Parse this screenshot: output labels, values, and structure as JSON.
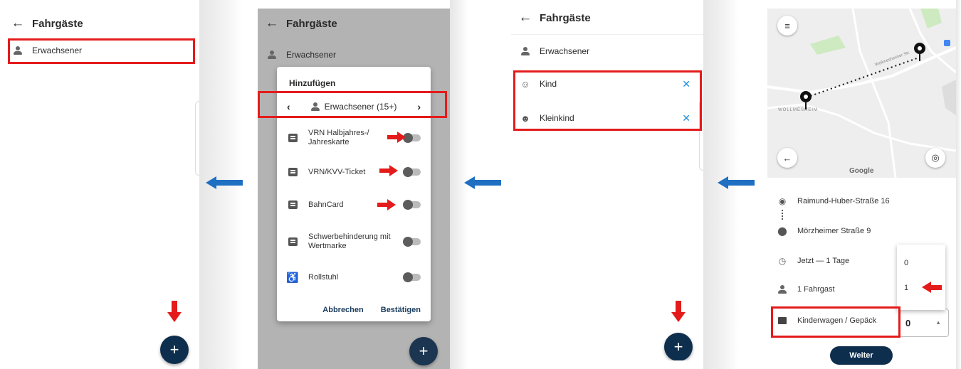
{
  "screen1": {
    "title": "Fahrgäste",
    "passenger": "Erwachsener",
    "fab": "+"
  },
  "screen2": {
    "title": "Fahrgäste",
    "passenger": "Erwachsener",
    "dialog": {
      "title": "Hinzufügen",
      "category": "Erwachsener (15+)",
      "prev": "‹",
      "next": "›",
      "options": [
        {
          "label": "VRN Halbjahres-/ Jahreskarte",
          "enabled": false
        },
        {
          "label": "VRN/KVV-Ticket",
          "enabled": false
        },
        {
          "label": "BahnCard",
          "enabled": false
        },
        {
          "label": "Schwerbehinderung mit Wertmarke",
          "enabled": false
        },
        {
          "label": "Rollstuhl",
          "enabled": false
        }
      ],
      "cancel": "Abbrechen",
      "confirm": "Bestätigen"
    },
    "fab": "+"
  },
  "screen3": {
    "title": "Fahrgäste",
    "passengers": [
      "Erwachsener",
      "Kind",
      "Kleinkind"
    ],
    "remove": "✕",
    "fab": "+"
  },
  "screen4": {
    "map": {
      "street": "Wollmesheimer Str.",
      "place": "WOLLMESHEIM",
      "brand": "Google"
    },
    "from": "Raimund-Huber-Straße 16",
    "to": "Mörzheimer Straße 9",
    "time": "Jetzt — 1 Tage",
    "passengers": "1 Fahrgast",
    "luggage_label": "Kinderwagen / Gepäck",
    "luggage_value": "0",
    "dropdown_options": [
      "0",
      "1"
    ],
    "button": "Weiter"
  },
  "colors": {
    "primary": "#0e2e4e",
    "highlight": "#e41b1b",
    "flow_arrow": "#1f6fc2",
    "remove_icon": "#1a8ad8"
  }
}
